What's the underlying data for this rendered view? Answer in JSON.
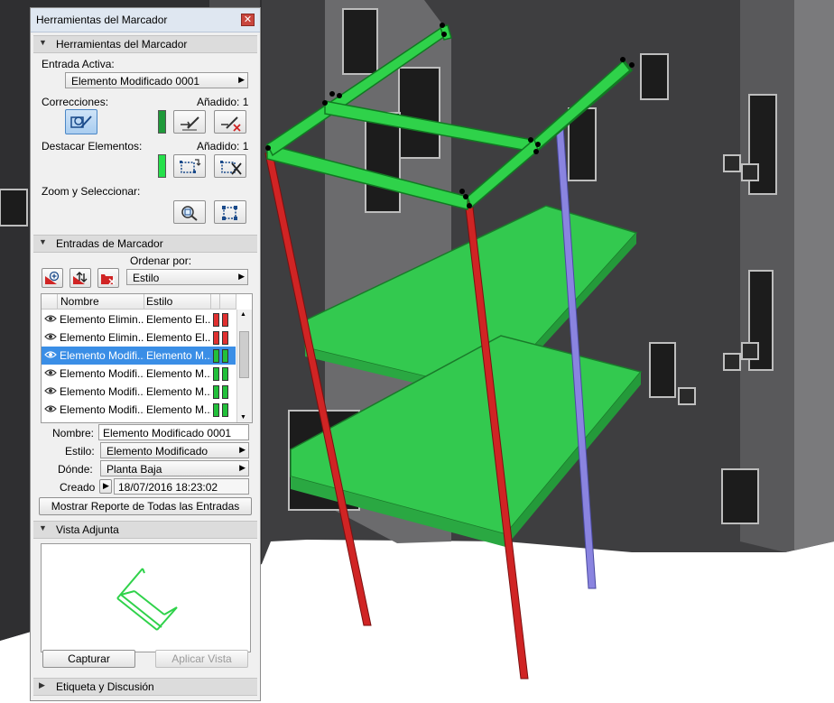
{
  "panel": {
    "title": "Herramientas del Marcador",
    "close_glyph": "✕",
    "marker_tools": {
      "header": "Herramientas del Marcador",
      "active_entry_label": "Entrada Activa:",
      "active_entry_value": "Elemento Modificado 0001",
      "corrections_label": "Correcciones:",
      "corrections_added": "Añadido: 1",
      "corrections_color": "#1f9a3a",
      "highlight_label": "Destacar Elementos:",
      "highlight_added": "Añadido: 1",
      "highlight_color": "#25e04a",
      "zoom_select_label": "Zoom y Seleccionar:"
    },
    "entries": {
      "header": "Entradas de Marcador",
      "sort_label": "Ordenar por:",
      "sort_value": "Estilo",
      "columns": {
        "name": "Nombre",
        "style": "Estilo"
      },
      "rows": [
        {
          "name": "Elemento Elimin...",
          "style": "Elemento El...",
          "color1": "#e03030",
          "color2": "#e03030"
        },
        {
          "name": "Elemento Elimin...",
          "style": "Elemento El...",
          "color1": "#e03030",
          "color2": "#e03030"
        },
        {
          "name": "Elemento Modifi...",
          "style": "Elemento M...",
          "color1": "#22c03a",
          "color2": "#22c03a"
        },
        {
          "name": "Elemento Modifi...",
          "style": "Elemento M...",
          "color1": "#22c03a",
          "color2": "#22c03a"
        },
        {
          "name": "Elemento Modifi...",
          "style": "Elemento M...",
          "color1": "#22c03a",
          "color2": "#22c03a"
        },
        {
          "name": "Elemento Modifi...",
          "style": "Elemento M...",
          "color1": "#22c03a",
          "color2": "#22c03a"
        }
      ],
      "name_label": "Nombre:",
      "name_value": "Elemento Modificado 0001",
      "style_label": "Estilo:",
      "style_value": "Elemento Modificado",
      "where_label": "Dónde:",
      "where_value": "Planta Baja",
      "created_label": "Creado",
      "created_value": "18/07/2016 18:23:02",
      "report_button": "Mostrar Reporte de Todas las Entradas"
    },
    "attached_view": {
      "header": "Vista Adjunta",
      "capture_button": "Capturar",
      "apply_button": "Aplicar Vista"
    },
    "label_discussion": {
      "header": "Etiqueta y Discusión"
    }
  }
}
